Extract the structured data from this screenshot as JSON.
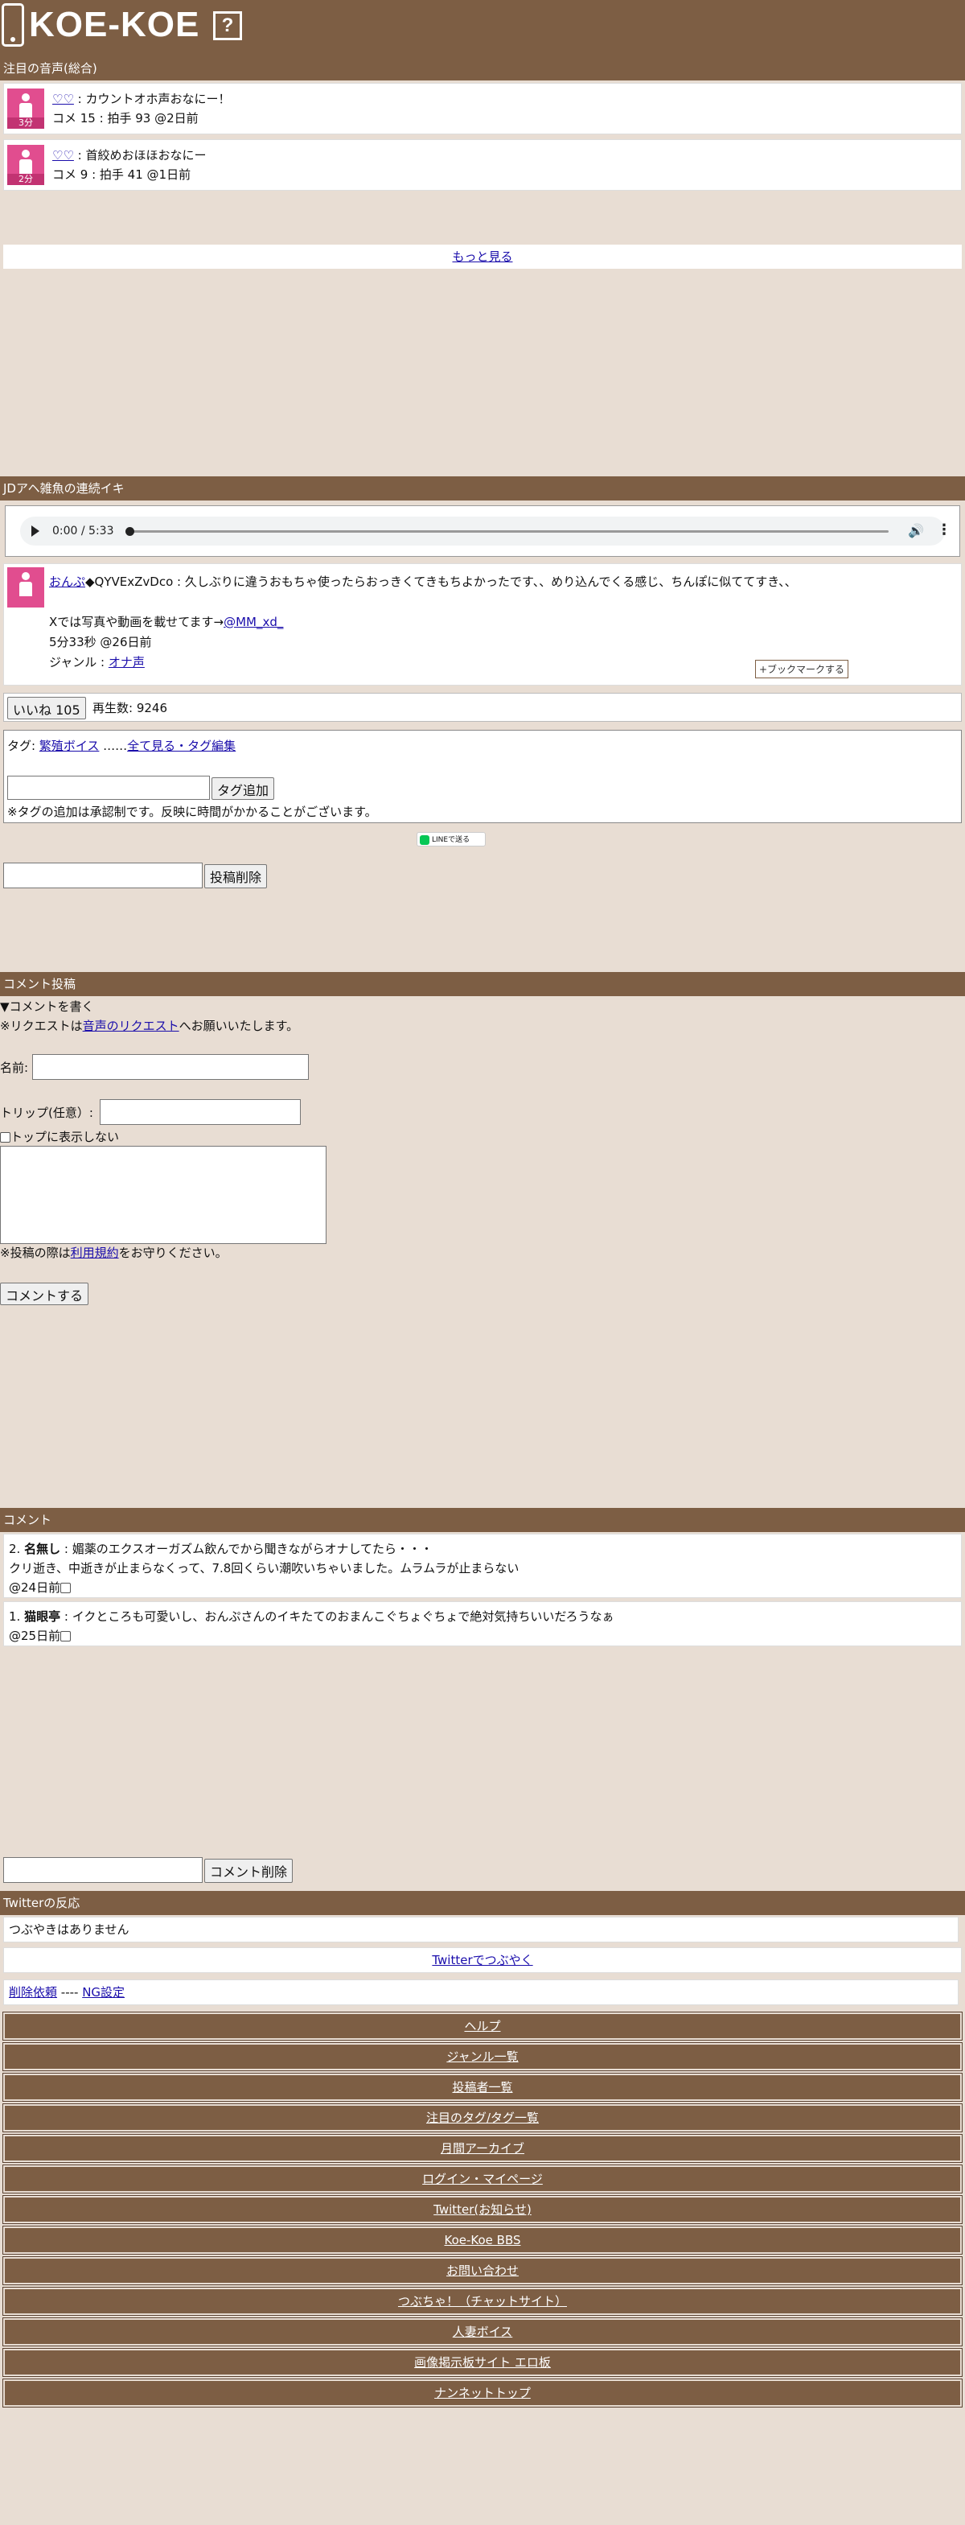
{
  "header": {
    "logo_text": "KOE-KOE",
    "help_label": "?"
  },
  "featured": {
    "title": "注目の音声(総合)",
    "items": [
      {
        "duration": "3分",
        "title": "♡♡",
        "desc": "カウントオホ声おなにー！",
        "meta": "コメ 15 : 拍手 93 @2日前"
      },
      {
        "duration": "2分",
        "title": "♡♡",
        "desc": "首絞めおほほおなにー",
        "meta": "コメ 9 : 拍手 41 @1日前"
      }
    ],
    "more_label": "もっと見る"
  },
  "post": {
    "title": "JDアヘ雑魚の連続イキ",
    "player": {
      "time": "0:00 / 5:33",
      "progress": 0
    },
    "author": "おんぷ",
    "author_id": "◆QYVExZvDco",
    "body": "久しぶりに違うおもちゃ使ったらおっきくてきもちよかったです、、めり込んでくる感じ、ちんぽに似ててすき、、",
    "x_note": "Xでは写真や動画を載せてます→",
    "x_handle": "@MM_xd_",
    "length": "5分33秒 @26日前",
    "genre_label": "ジャンル : ",
    "genre": "オナ声",
    "bookmark_label": "+ブックマークする",
    "like_label": "いいね 105",
    "plays": "再生数: 9246"
  },
  "tags": {
    "prefix": "タグ: ",
    "tag": "繁殖ボイス",
    "dots": " ……",
    "all_link": "全て見る・タグ編集",
    "add_button": "タグ追加",
    "note": "※タグの追加は承認制です。反映に時間がかかることがございます。"
  },
  "line_share": "LINEで送る",
  "delete_post_label": "投稿削除",
  "comment_form": {
    "title": "コメント投稿",
    "toggle": "▼コメントを書く",
    "request_prefix": "※リクエストは",
    "request_link": "音声のリクエスト",
    "request_suffix": "へお願いいたします。",
    "name_label": "名前:",
    "trip_label": "トリップ(任意）:",
    "hide_label": "トップに表示しない",
    "rules_prefix": "※投稿の際は",
    "rules_link": "利用規約",
    "rules_suffix": "をお守りください。",
    "submit": "コメントする"
  },
  "comments": {
    "title": "コメント",
    "items": [
      {
        "num": "2.",
        "name": "名無し",
        "text": "媚薬のエクスオーガズム飲んでから聞きながらオナしてたら・・・",
        "text2": "クリ逝き、中逝きが止まらなくって、7.8回くらい潮吹いちゃいました。ムラムラが止まらない",
        "time": "@24日前"
      },
      {
        "num": "1.",
        "name": "猫眼亭",
        "text": "イクところも可愛いし、おんぷさんのイキたてのおまんこぐちょぐちょで絶対気持ちいいだろうなぁ",
        "text2": "",
        "time": "@25日前"
      }
    ],
    "delete_label": "コメント削除"
  },
  "twitter": {
    "title": "Twitterの反応",
    "empty": "つぶやきはありません",
    "tweet_link": "Twitterでつぶやく"
  },
  "report": {
    "delete_request": "削除依頼",
    "sep": " ---- ",
    "ng": "NG設定"
  },
  "footer_links": [
    "ヘルプ",
    "ジャンル一覧",
    "投稿者一覧",
    "注目のタグ/タグ一覧",
    "月間アーカイブ",
    "ログイン・マイページ",
    "Twitter(お知らせ)",
    "Koe-Koe BBS",
    "お問い合わせ",
    "つぶちゃ！（チャットサイト）",
    "人妻ボイス",
    "画像掲示板サイト エロ板",
    "ナンネットトップ"
  ]
}
